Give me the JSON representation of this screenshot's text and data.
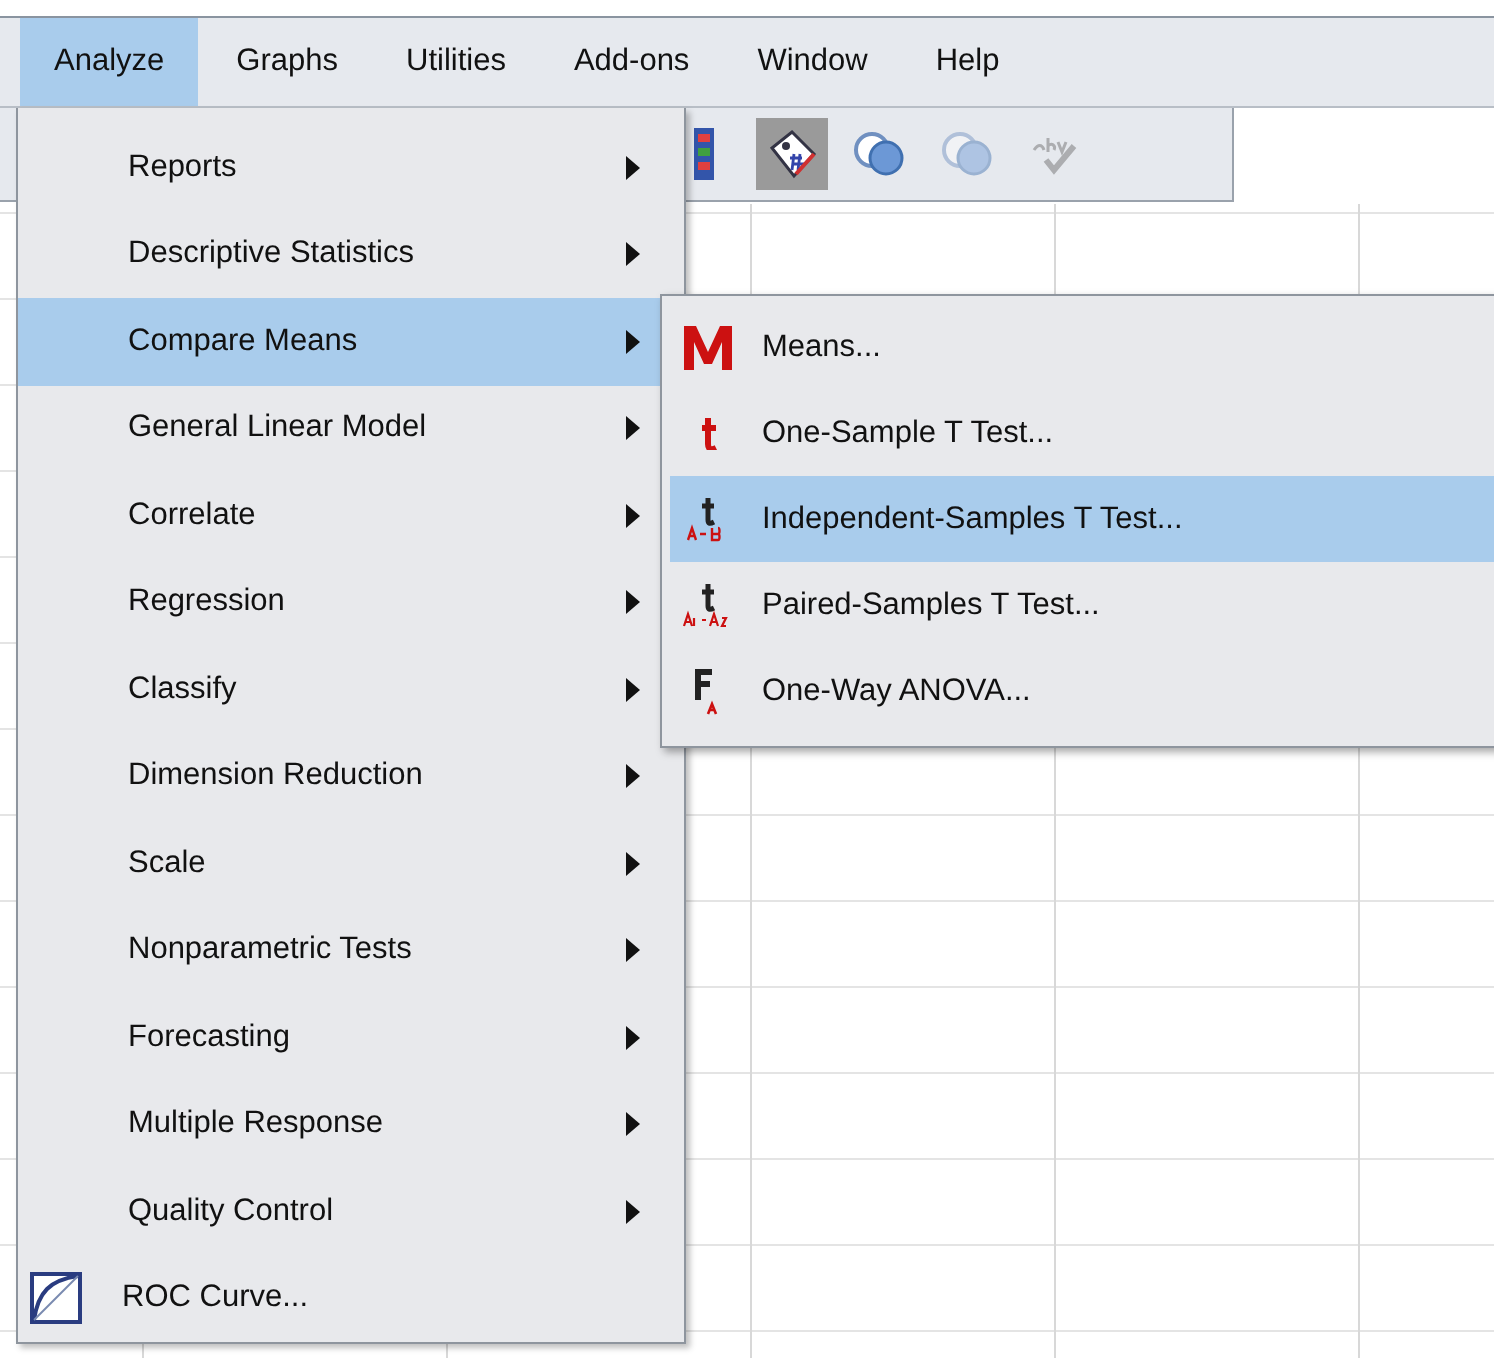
{
  "menubar": [
    {
      "label": "Analyze",
      "selected": true
    },
    {
      "label": "Graphs",
      "selected": false
    },
    {
      "label": "Utilities",
      "selected": false
    },
    {
      "label": "Add-ons",
      "selected": false
    },
    {
      "label": "Window",
      "selected": false
    },
    {
      "label": "Help",
      "selected": false
    }
  ],
  "toolbar": [
    {
      "kind": "grid",
      "pressed": false,
      "disabled": false
    },
    {
      "kind": "tag",
      "pressed": true,
      "disabled": false
    },
    {
      "kind": "circles",
      "pressed": false,
      "disabled": false
    },
    {
      "kind": "circles",
      "pressed": false,
      "disabled": true
    },
    {
      "kind": "spell",
      "pressed": false,
      "disabled": true
    }
  ],
  "menu": [
    {
      "label": "Reports",
      "kind": "submenu",
      "selected": false
    },
    {
      "label": "Descriptive Statistics",
      "kind": "submenu",
      "selected": false
    },
    {
      "label": "Compare Means",
      "kind": "submenu",
      "selected": true
    },
    {
      "label": "General Linear Model",
      "kind": "submenu",
      "selected": false
    },
    {
      "label": "Correlate",
      "kind": "submenu",
      "selected": false
    },
    {
      "label": "Regression",
      "kind": "submenu",
      "selected": false
    },
    {
      "label": "Classify",
      "kind": "submenu",
      "selected": false
    },
    {
      "label": "Dimension Reduction",
      "kind": "submenu",
      "selected": false
    },
    {
      "label": "Scale",
      "kind": "submenu",
      "selected": false
    },
    {
      "label": "Nonparametric Tests",
      "kind": "submenu",
      "selected": false
    },
    {
      "label": "Forecasting",
      "kind": "submenu",
      "selected": false
    },
    {
      "label": "Multiple Response",
      "kind": "submenu",
      "selected": false
    },
    {
      "label": "Quality Control",
      "kind": "submenu",
      "selected": false
    },
    {
      "label": "ROC Curve...",
      "kind": "command",
      "selected": false
    }
  ],
  "submenu": [
    {
      "label": "Means...",
      "kind": "means",
      "selected": false
    },
    {
      "label": "One-Sample T Test...",
      "kind": "one-sample",
      "selected": false
    },
    {
      "label": "Independent-Samples T Test...",
      "kind": "independent",
      "selected": true
    },
    {
      "label": "Paired-Samples T Test...",
      "kind": "paired",
      "selected": false
    },
    {
      "label": "One-Way ANOVA...",
      "kind": "anova",
      "selected": false
    }
  ]
}
